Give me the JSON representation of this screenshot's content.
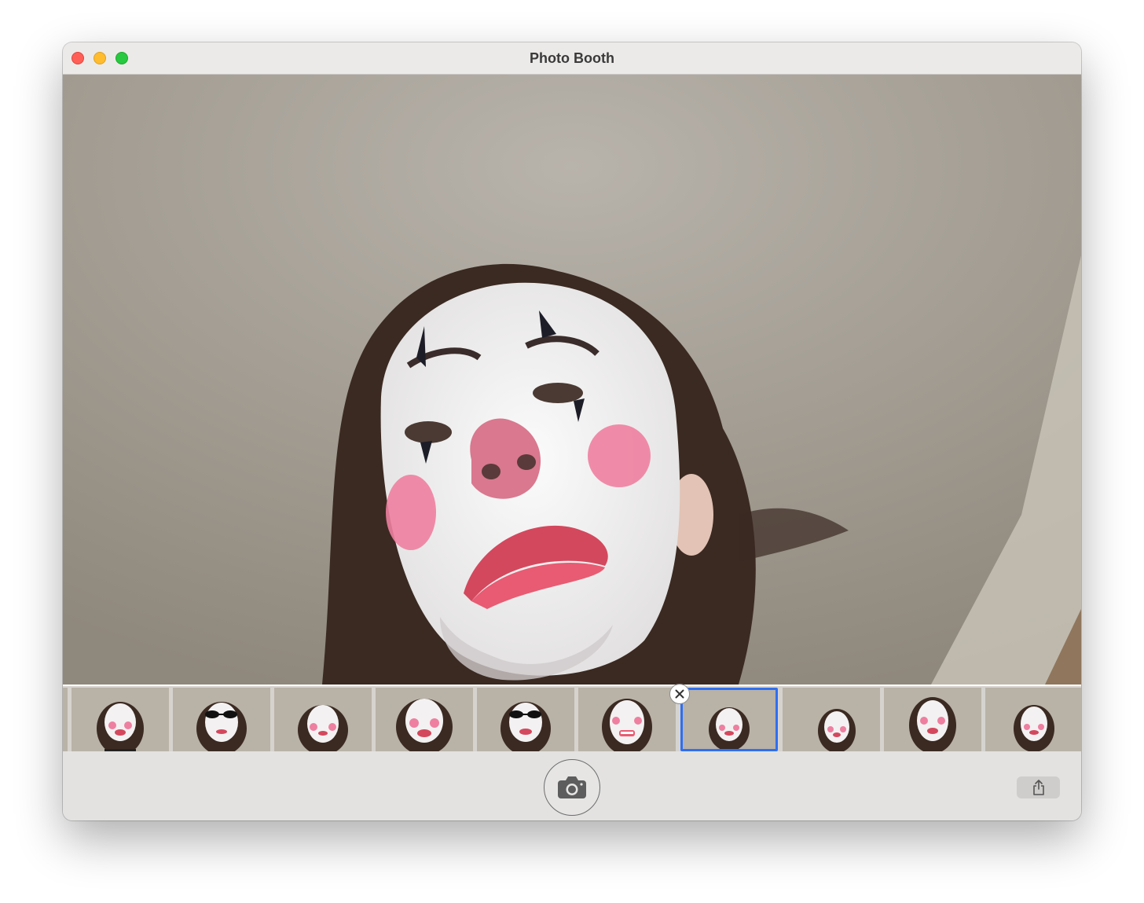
{
  "window": {
    "title": "Photo Booth"
  },
  "viewer": {
    "content": "live-camera-preview"
  },
  "filmstrip": {
    "thumbnail_count": 11,
    "selected_index": 6,
    "remove_icon": "close-x-icon"
  },
  "toolbar": {
    "shutter_icon": "camera-icon",
    "share_icon": "share-icon"
  },
  "colors": {
    "selection": "#2f6ff0",
    "close_light": "#ff5f57",
    "minimize_light": "#febc2e",
    "zoom_light": "#28c840"
  }
}
